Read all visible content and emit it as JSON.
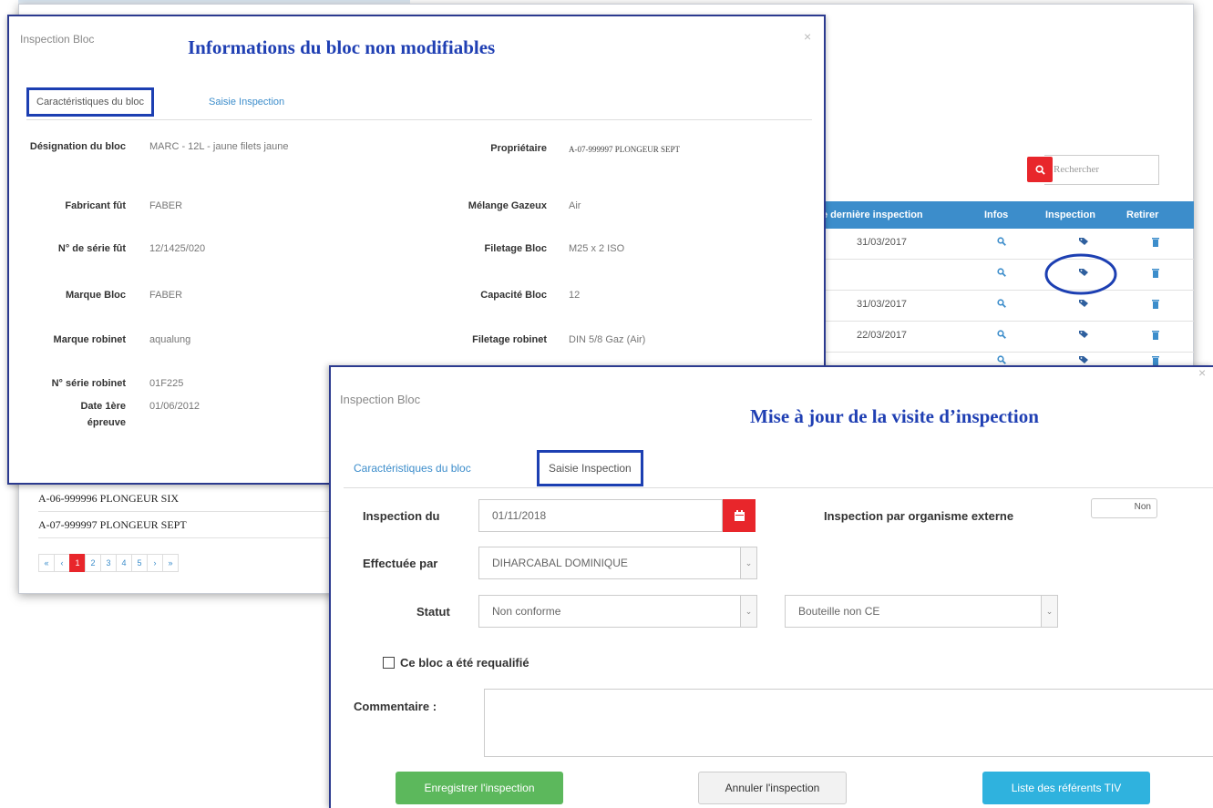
{
  "list_window": {
    "search_placeholder": "Rechercher",
    "table": {
      "headers": [
        "e dernière inspection",
        "Infos",
        "Inspection",
        "Retirer"
      ],
      "rows": [
        {
          "date": "31/03/2017"
        },
        {
          "date": ""
        },
        {
          "date": "31/03/2017"
        },
        {
          "date": "22/03/2017"
        },
        {
          "date": ""
        }
      ]
    },
    "owners": [
      "A-06-999996 PLONGEUR SIX",
      "A-07-999997 PLONGEUR SEPT"
    ],
    "pagination": [
      "«",
      "‹",
      "1",
      "2",
      "3",
      "4",
      "5",
      "›",
      "»"
    ],
    "active_page": "1"
  },
  "modal1": {
    "title": "Inspection Bloc",
    "close": "×",
    "overlay_note": "Informations du bloc non modifiables",
    "tabs": [
      "Caractéristiques du bloc",
      "Saisie Inspection"
    ],
    "left_fields": [
      {
        "label": "Désignation du bloc",
        "value": "MARC - 12L - jaune filets jaune"
      },
      {
        "label": "Fabricant fût",
        "value": "FABER"
      },
      {
        "label": "N° de série fût",
        "value": "12/1425/020"
      },
      {
        "label": "Marque Bloc",
        "value": "FABER"
      },
      {
        "label": "Marque robinet",
        "value": "aqualung"
      },
      {
        "label": "N° série robinet",
        "value": "01F225"
      },
      {
        "label": "Date 1ère épreuve",
        "value": "01/06/2012"
      }
    ],
    "right_fields": [
      {
        "label": "Propriétaire",
        "value": "A-07-999997 PLONGEUR SEPT"
      },
      {
        "label": "Mélange Gazeux",
        "value": "Air"
      },
      {
        "label": "Filetage Bloc",
        "value": "M25 x 2 ISO"
      },
      {
        "label": "Capacité Bloc",
        "value": "12"
      },
      {
        "label": "Filetage robinet",
        "value": "DIN 5/8 Gaz (Air)"
      }
    ]
  },
  "modal2": {
    "title": "Inspection Bloc",
    "close": "×",
    "overlay_note": "Mise à jour de la visite d’inspection",
    "tabs": [
      "Caractéristiques du bloc",
      "Saisie Inspection"
    ],
    "inspection_date_label": "Inspection du",
    "inspection_date": "01/11/2018",
    "external_label": "Inspection par organisme externe",
    "external_value": "Non",
    "performed_by_label": "Effectuée par",
    "performed_by": "DIHARCABAL DOMINIQUE",
    "status_label": "Statut",
    "status": "Non conforme",
    "status_detail": "Bouteille non CE",
    "requalified_label": "Ce bloc a été requalifié",
    "comment_label": "Commentaire :",
    "buttons": {
      "save": "Enregistrer l'inspection",
      "cancel": "Annuler l'inspection",
      "tiv": "Liste des référents TIV"
    }
  },
  "colors": {
    "primary_blue": "#3c8dcb",
    "danger_red": "#e8262b",
    "annotation_blue": "#1c3fb2",
    "success_green": "#5cb85c",
    "info_cyan": "#2fb2de"
  },
  "icons": [
    "search-icon",
    "magnifier-icon",
    "tag-icon",
    "trash-icon",
    "calendar-icon",
    "chevron-down-icon"
  ]
}
